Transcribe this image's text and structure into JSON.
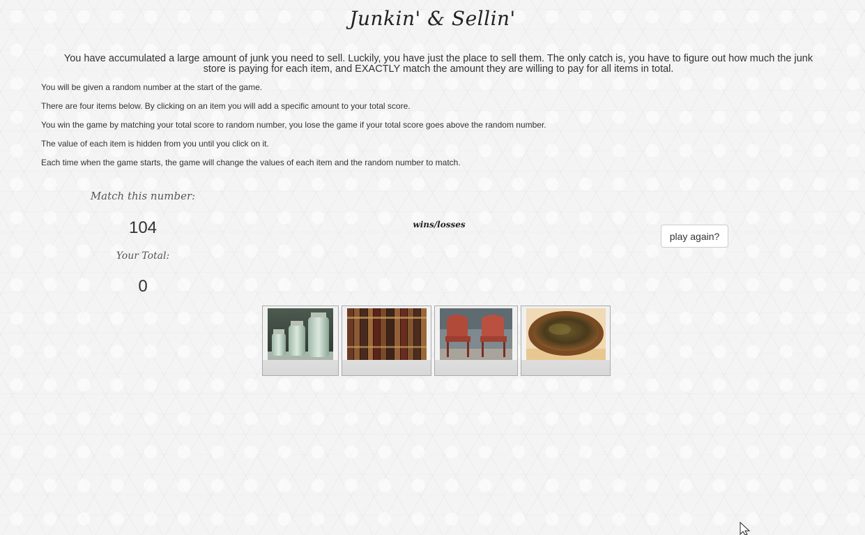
{
  "title": "Junkin' & Sellin'",
  "intro": "You have accumulated a large amount of junk you need to sell. Luckily, you have just the place to sell them. The only catch is, you have to figure out how much the junk store is paying for each item, and EXACTLY match the amount they are willing to pay for all items in total.",
  "rules": [
    "You will be given a random number at the start of the game.",
    "There are four items below. By clicking on an item you will add a specific amount to your total score.",
    "You win the game by matching your total score to random number, you lose the game if your total score goes above the random number.",
    "The value of each item is hidden from you until you click on it.",
    "Each time when the game starts, the game will change the values of each item and the random number to match."
  ],
  "match": {
    "label": "Match this number:",
    "value": "104"
  },
  "total": {
    "label": "Your Total:",
    "value": "0"
  },
  "wins_losses": "wins/losses",
  "play_again_label": "play again?",
  "items": [
    {
      "name": "jars",
      "icon": "mason-jars-image"
    },
    {
      "name": "books",
      "icon": "old-books-image"
    },
    {
      "name": "chairs",
      "icon": "metal-chairs-image"
    },
    {
      "name": "skillet",
      "icon": "rusty-skillet-image"
    }
  ]
}
